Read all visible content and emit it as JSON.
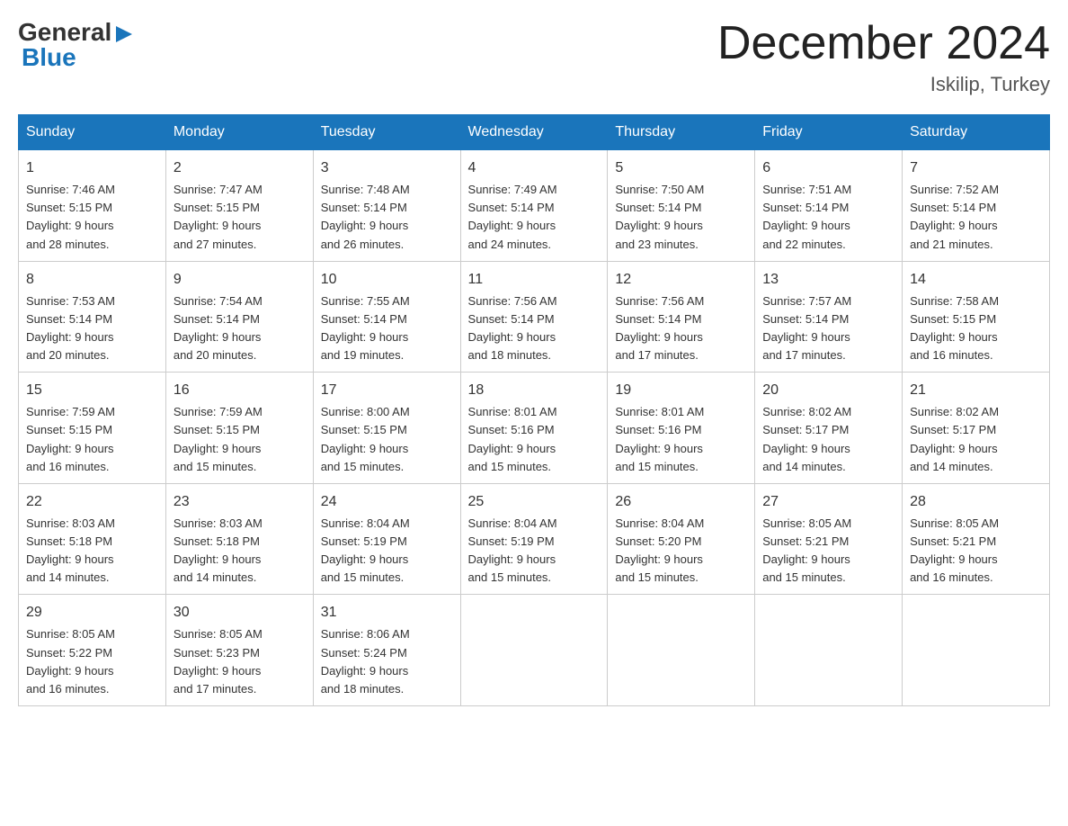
{
  "header": {
    "logo_general": "General",
    "logo_blue": "Blue",
    "month_title": "December 2024",
    "location": "Iskilip, Turkey"
  },
  "days_of_week": [
    "Sunday",
    "Monday",
    "Tuesday",
    "Wednesday",
    "Thursday",
    "Friday",
    "Saturday"
  ],
  "weeks": [
    [
      {
        "date": "1",
        "sunrise": "Sunrise: 7:46 AM",
        "sunset": "Sunset: 5:15 PM",
        "daylight": "Daylight: 9 hours",
        "daylight2": "and 28 minutes."
      },
      {
        "date": "2",
        "sunrise": "Sunrise: 7:47 AM",
        "sunset": "Sunset: 5:15 PM",
        "daylight": "Daylight: 9 hours",
        "daylight2": "and 27 minutes."
      },
      {
        "date": "3",
        "sunrise": "Sunrise: 7:48 AM",
        "sunset": "Sunset: 5:14 PM",
        "daylight": "Daylight: 9 hours",
        "daylight2": "and 26 minutes."
      },
      {
        "date": "4",
        "sunrise": "Sunrise: 7:49 AM",
        "sunset": "Sunset: 5:14 PM",
        "daylight": "Daylight: 9 hours",
        "daylight2": "and 24 minutes."
      },
      {
        "date": "5",
        "sunrise": "Sunrise: 7:50 AM",
        "sunset": "Sunset: 5:14 PM",
        "daylight": "Daylight: 9 hours",
        "daylight2": "and 23 minutes."
      },
      {
        "date": "6",
        "sunrise": "Sunrise: 7:51 AM",
        "sunset": "Sunset: 5:14 PM",
        "daylight": "Daylight: 9 hours",
        "daylight2": "and 22 minutes."
      },
      {
        "date": "7",
        "sunrise": "Sunrise: 7:52 AM",
        "sunset": "Sunset: 5:14 PM",
        "daylight": "Daylight: 9 hours",
        "daylight2": "and 21 minutes."
      }
    ],
    [
      {
        "date": "8",
        "sunrise": "Sunrise: 7:53 AM",
        "sunset": "Sunset: 5:14 PM",
        "daylight": "Daylight: 9 hours",
        "daylight2": "and 20 minutes."
      },
      {
        "date": "9",
        "sunrise": "Sunrise: 7:54 AM",
        "sunset": "Sunset: 5:14 PM",
        "daylight": "Daylight: 9 hours",
        "daylight2": "and 20 minutes."
      },
      {
        "date": "10",
        "sunrise": "Sunrise: 7:55 AM",
        "sunset": "Sunset: 5:14 PM",
        "daylight": "Daylight: 9 hours",
        "daylight2": "and 19 minutes."
      },
      {
        "date": "11",
        "sunrise": "Sunrise: 7:56 AM",
        "sunset": "Sunset: 5:14 PM",
        "daylight": "Daylight: 9 hours",
        "daylight2": "and 18 minutes."
      },
      {
        "date": "12",
        "sunrise": "Sunrise: 7:56 AM",
        "sunset": "Sunset: 5:14 PM",
        "daylight": "Daylight: 9 hours",
        "daylight2": "and 17 minutes."
      },
      {
        "date": "13",
        "sunrise": "Sunrise: 7:57 AM",
        "sunset": "Sunset: 5:14 PM",
        "daylight": "Daylight: 9 hours",
        "daylight2": "and 17 minutes."
      },
      {
        "date": "14",
        "sunrise": "Sunrise: 7:58 AM",
        "sunset": "Sunset: 5:15 PM",
        "daylight": "Daylight: 9 hours",
        "daylight2": "and 16 minutes."
      }
    ],
    [
      {
        "date": "15",
        "sunrise": "Sunrise: 7:59 AM",
        "sunset": "Sunset: 5:15 PM",
        "daylight": "Daylight: 9 hours",
        "daylight2": "and 16 minutes."
      },
      {
        "date": "16",
        "sunrise": "Sunrise: 7:59 AM",
        "sunset": "Sunset: 5:15 PM",
        "daylight": "Daylight: 9 hours",
        "daylight2": "and 15 minutes."
      },
      {
        "date": "17",
        "sunrise": "Sunrise: 8:00 AM",
        "sunset": "Sunset: 5:15 PM",
        "daylight": "Daylight: 9 hours",
        "daylight2": "and 15 minutes."
      },
      {
        "date": "18",
        "sunrise": "Sunrise: 8:01 AM",
        "sunset": "Sunset: 5:16 PM",
        "daylight": "Daylight: 9 hours",
        "daylight2": "and 15 minutes."
      },
      {
        "date": "19",
        "sunrise": "Sunrise: 8:01 AM",
        "sunset": "Sunset: 5:16 PM",
        "daylight": "Daylight: 9 hours",
        "daylight2": "and 15 minutes."
      },
      {
        "date": "20",
        "sunrise": "Sunrise: 8:02 AM",
        "sunset": "Sunset: 5:17 PM",
        "daylight": "Daylight: 9 hours",
        "daylight2": "and 14 minutes."
      },
      {
        "date": "21",
        "sunrise": "Sunrise: 8:02 AM",
        "sunset": "Sunset: 5:17 PM",
        "daylight": "Daylight: 9 hours",
        "daylight2": "and 14 minutes."
      }
    ],
    [
      {
        "date": "22",
        "sunrise": "Sunrise: 8:03 AM",
        "sunset": "Sunset: 5:18 PM",
        "daylight": "Daylight: 9 hours",
        "daylight2": "and 14 minutes."
      },
      {
        "date": "23",
        "sunrise": "Sunrise: 8:03 AM",
        "sunset": "Sunset: 5:18 PM",
        "daylight": "Daylight: 9 hours",
        "daylight2": "and 14 minutes."
      },
      {
        "date": "24",
        "sunrise": "Sunrise: 8:04 AM",
        "sunset": "Sunset: 5:19 PM",
        "daylight": "Daylight: 9 hours",
        "daylight2": "and 15 minutes."
      },
      {
        "date": "25",
        "sunrise": "Sunrise: 8:04 AM",
        "sunset": "Sunset: 5:19 PM",
        "daylight": "Daylight: 9 hours",
        "daylight2": "and 15 minutes."
      },
      {
        "date": "26",
        "sunrise": "Sunrise: 8:04 AM",
        "sunset": "Sunset: 5:20 PM",
        "daylight": "Daylight: 9 hours",
        "daylight2": "and 15 minutes."
      },
      {
        "date": "27",
        "sunrise": "Sunrise: 8:05 AM",
        "sunset": "Sunset: 5:21 PM",
        "daylight": "Daylight: 9 hours",
        "daylight2": "and 15 minutes."
      },
      {
        "date": "28",
        "sunrise": "Sunrise: 8:05 AM",
        "sunset": "Sunset: 5:21 PM",
        "daylight": "Daylight: 9 hours",
        "daylight2": "and 16 minutes."
      }
    ],
    [
      {
        "date": "29",
        "sunrise": "Sunrise: 8:05 AM",
        "sunset": "Sunset: 5:22 PM",
        "daylight": "Daylight: 9 hours",
        "daylight2": "and 16 minutes."
      },
      {
        "date": "30",
        "sunrise": "Sunrise: 8:05 AM",
        "sunset": "Sunset: 5:23 PM",
        "daylight": "Daylight: 9 hours",
        "daylight2": "and 17 minutes."
      },
      {
        "date": "31",
        "sunrise": "Sunrise: 8:06 AM",
        "sunset": "Sunset: 5:24 PM",
        "daylight": "Daylight: 9 hours",
        "daylight2": "and 18 minutes."
      },
      null,
      null,
      null,
      null
    ]
  ]
}
